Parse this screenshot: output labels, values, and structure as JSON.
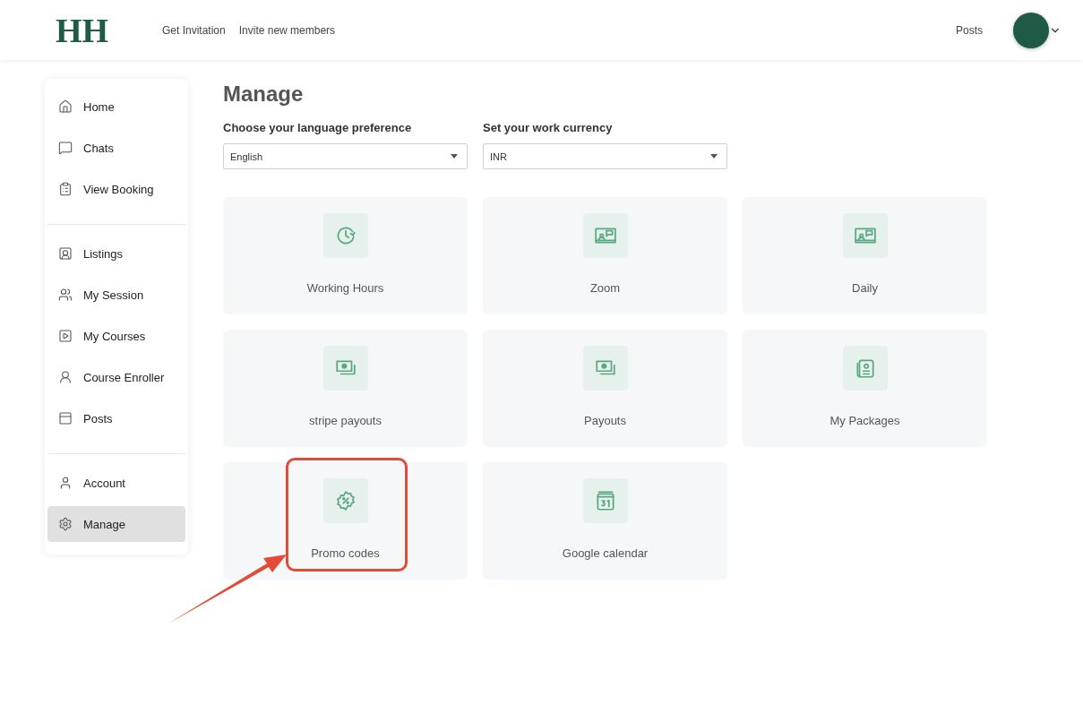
{
  "header": {
    "logo": "HH",
    "links": [
      "Get Invitation",
      "Invite new members"
    ],
    "right_link": "Posts"
  },
  "sidebar": {
    "groups": [
      [
        {
          "label": "Home",
          "selected": false
        },
        {
          "label": "Chats",
          "selected": false
        },
        {
          "label": "View Booking",
          "selected": false
        }
      ],
      [
        {
          "label": "Listings",
          "selected": false
        },
        {
          "label": "My Session",
          "selected": false
        },
        {
          "label": "My Courses",
          "selected": false
        },
        {
          "label": "Course Enroller",
          "selected": false
        },
        {
          "label": "Posts",
          "selected": false
        }
      ],
      [
        {
          "label": "Account",
          "selected": false
        },
        {
          "label": "Manage",
          "selected": true
        }
      ]
    ]
  },
  "page": {
    "title": "Manage",
    "selects": [
      {
        "label": "Choose your language preference",
        "value": "English"
      },
      {
        "label": "Set your work currency",
        "value": "INR"
      }
    ],
    "tiles": [
      {
        "label": "Working Hours",
        "kind": "clock",
        "highlighted": false
      },
      {
        "label": "Zoom",
        "kind": "presentation",
        "highlighted": false
      },
      {
        "label": "Daily",
        "kind": "presentation",
        "highlighted": false
      },
      {
        "label": "stripe payouts",
        "kind": "money",
        "highlighted": false
      },
      {
        "label": "Payouts",
        "kind": "money",
        "highlighted": false
      },
      {
        "label": "My Packages",
        "kind": "package",
        "highlighted": false
      },
      {
        "label": "Promo codes",
        "kind": "promo",
        "highlighted": true
      },
      {
        "label": "Google calendar",
        "kind": "calendar",
        "highlighted": false
      }
    ]
  }
}
